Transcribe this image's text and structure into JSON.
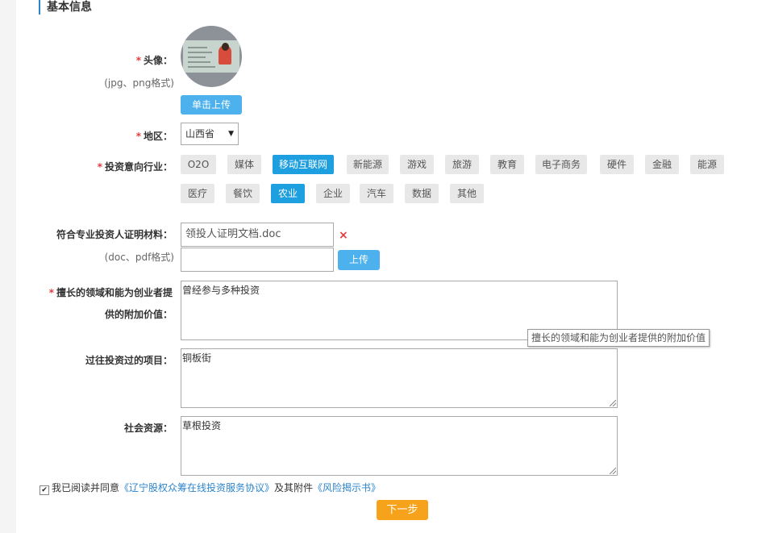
{
  "section_title": "基本信息",
  "avatar": {
    "label": "头像：",
    "hint": "(jpg、png格式)",
    "upload_button": "单击上传"
  },
  "region": {
    "label": "地区：",
    "selected": "山西省"
  },
  "industry": {
    "label": "投资意向行业：",
    "tags": [
      {
        "label": "O2O",
        "selected": false
      },
      {
        "label": "媒体",
        "selected": false
      },
      {
        "label": "移动互联网",
        "selected": true
      },
      {
        "label": "新能源",
        "selected": false
      },
      {
        "label": "游戏",
        "selected": false
      },
      {
        "label": "旅游",
        "selected": false
      },
      {
        "label": "教育",
        "selected": false
      },
      {
        "label": "电子商务",
        "selected": false
      },
      {
        "label": "硬件",
        "selected": false
      },
      {
        "label": "金融",
        "selected": false
      },
      {
        "label": "能源",
        "selected": false
      },
      {
        "label": "医疗",
        "selected": false
      },
      {
        "label": "餐饮",
        "selected": false
      },
      {
        "label": "农业",
        "selected": true
      },
      {
        "label": "企业",
        "selected": false
      },
      {
        "label": "汽车",
        "selected": false
      },
      {
        "label": "数据",
        "selected": false
      },
      {
        "label": "其他",
        "selected": false
      }
    ]
  },
  "certificate": {
    "label": "符合专业投资人证明材料：",
    "hint": "(doc、pdf格式)",
    "file_name": "领投人证明文档.doc",
    "remove_icon": "×",
    "upload_button": "上传"
  },
  "expertise": {
    "label_line1": "擅长的领域和能为创业者提",
    "label_line2": "供的附加价值：",
    "value": "曾经参与多种投资",
    "tooltip": "擅长的领域和能为创业者提供的附加价值"
  },
  "past_projects": {
    "label": "过往投资过的项目：",
    "value": "铜板街"
  },
  "social_resources": {
    "label": "社会资源：",
    "value": "草根投资"
  },
  "agreement": {
    "prefix": "我已阅读并同意",
    "link1": "《辽宁股权众筹在线投资服务协议》",
    "middle": "及其附件",
    "link2": "《风险揭示书》",
    "checked": true
  },
  "next_button": "下一步",
  "colors": {
    "accent_blue": "#4cb1ec",
    "tag_selected": "#1e9fe0",
    "required_red": "#e4393c",
    "next_orange": "#f7a21b"
  }
}
